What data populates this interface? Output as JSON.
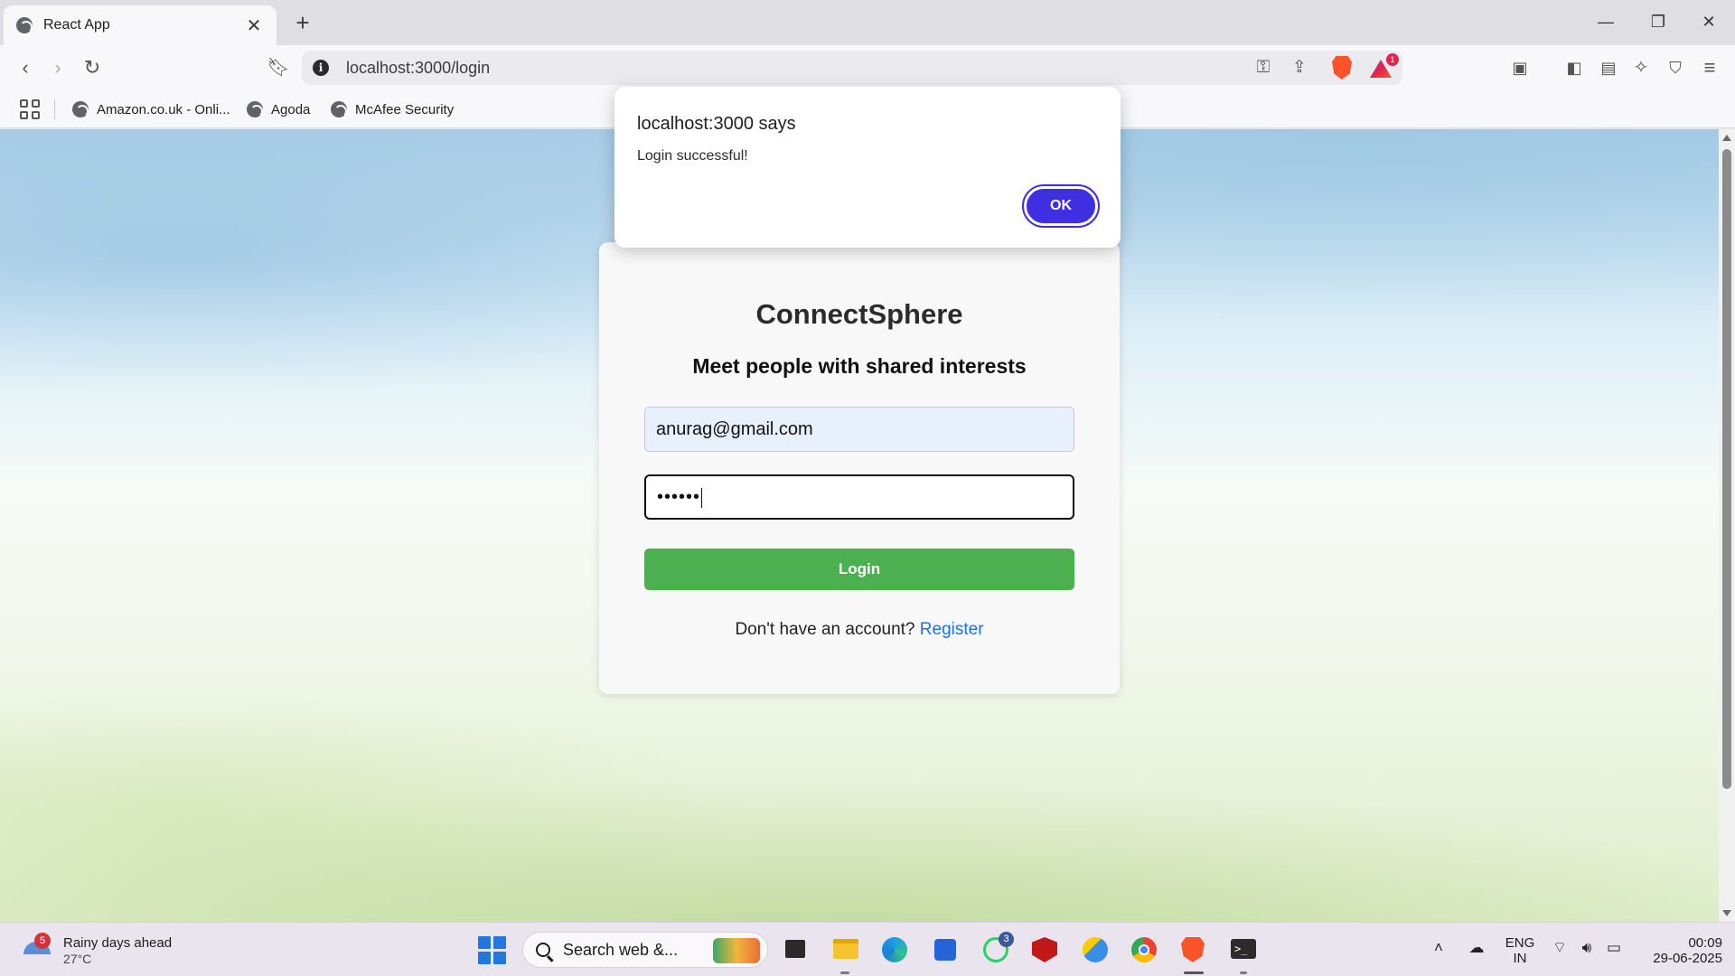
{
  "browser": {
    "tab_title": "React App",
    "url": "localhost:3000/login",
    "bookmarks": [
      "Amazon.co.uk - Onli...",
      "Agoda",
      "McAfee Security"
    ],
    "rewards_badge": "1"
  },
  "dialog": {
    "title": "localhost:3000 says",
    "message": "Login successful!",
    "ok_label": "OK"
  },
  "login": {
    "brand": "ConnectSphere",
    "tagline": "Meet people with shared interests",
    "email_value": "anurag@gmail.com",
    "password_mask": "••••••",
    "button_label": "Login",
    "register_prompt": "Don't have an account?",
    "register_link": "Register",
    "colors": {
      "button": "#4caf50",
      "link": "#1a73e8",
      "ok_button": "#3e2fe0"
    }
  },
  "taskbar": {
    "weather_badge": "5",
    "weather_text": "Rainy days ahead",
    "weather_temp": "27°C",
    "search_placeholder": "Search web &...",
    "whatsapp_badge": "3",
    "lang_primary": "ENG",
    "lang_secondary": "IN",
    "time": "00:09",
    "date": "29-06-2025"
  }
}
